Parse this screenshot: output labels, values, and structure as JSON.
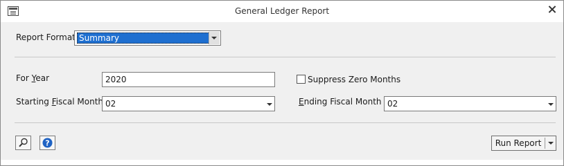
{
  "window": {
    "title": "General Ledger Report",
    "app_icon": "report-form-icon",
    "close_icon": "close-icon"
  },
  "report_format": {
    "label": "Report Format",
    "value": "Summary"
  },
  "for_year": {
    "label_pre": "For ",
    "label_u": "Y",
    "label_post": "ear",
    "value": "2020"
  },
  "suppress_zero": {
    "label": "Suppress Zero Months",
    "checked": false
  },
  "starting_month": {
    "label_pre": "Starting ",
    "label_u": "F",
    "label_post": "iscal Month",
    "value": "02"
  },
  "ending_month": {
    "label_pre": "",
    "label_u": "E",
    "label_post": "nding Fiscal Month",
    "value": "02"
  },
  "toolbar": {
    "preview_icon": "magnifier-icon",
    "help_icon": "help-icon",
    "help_glyph": "?"
  },
  "run_report": {
    "label": "Run Report"
  }
}
